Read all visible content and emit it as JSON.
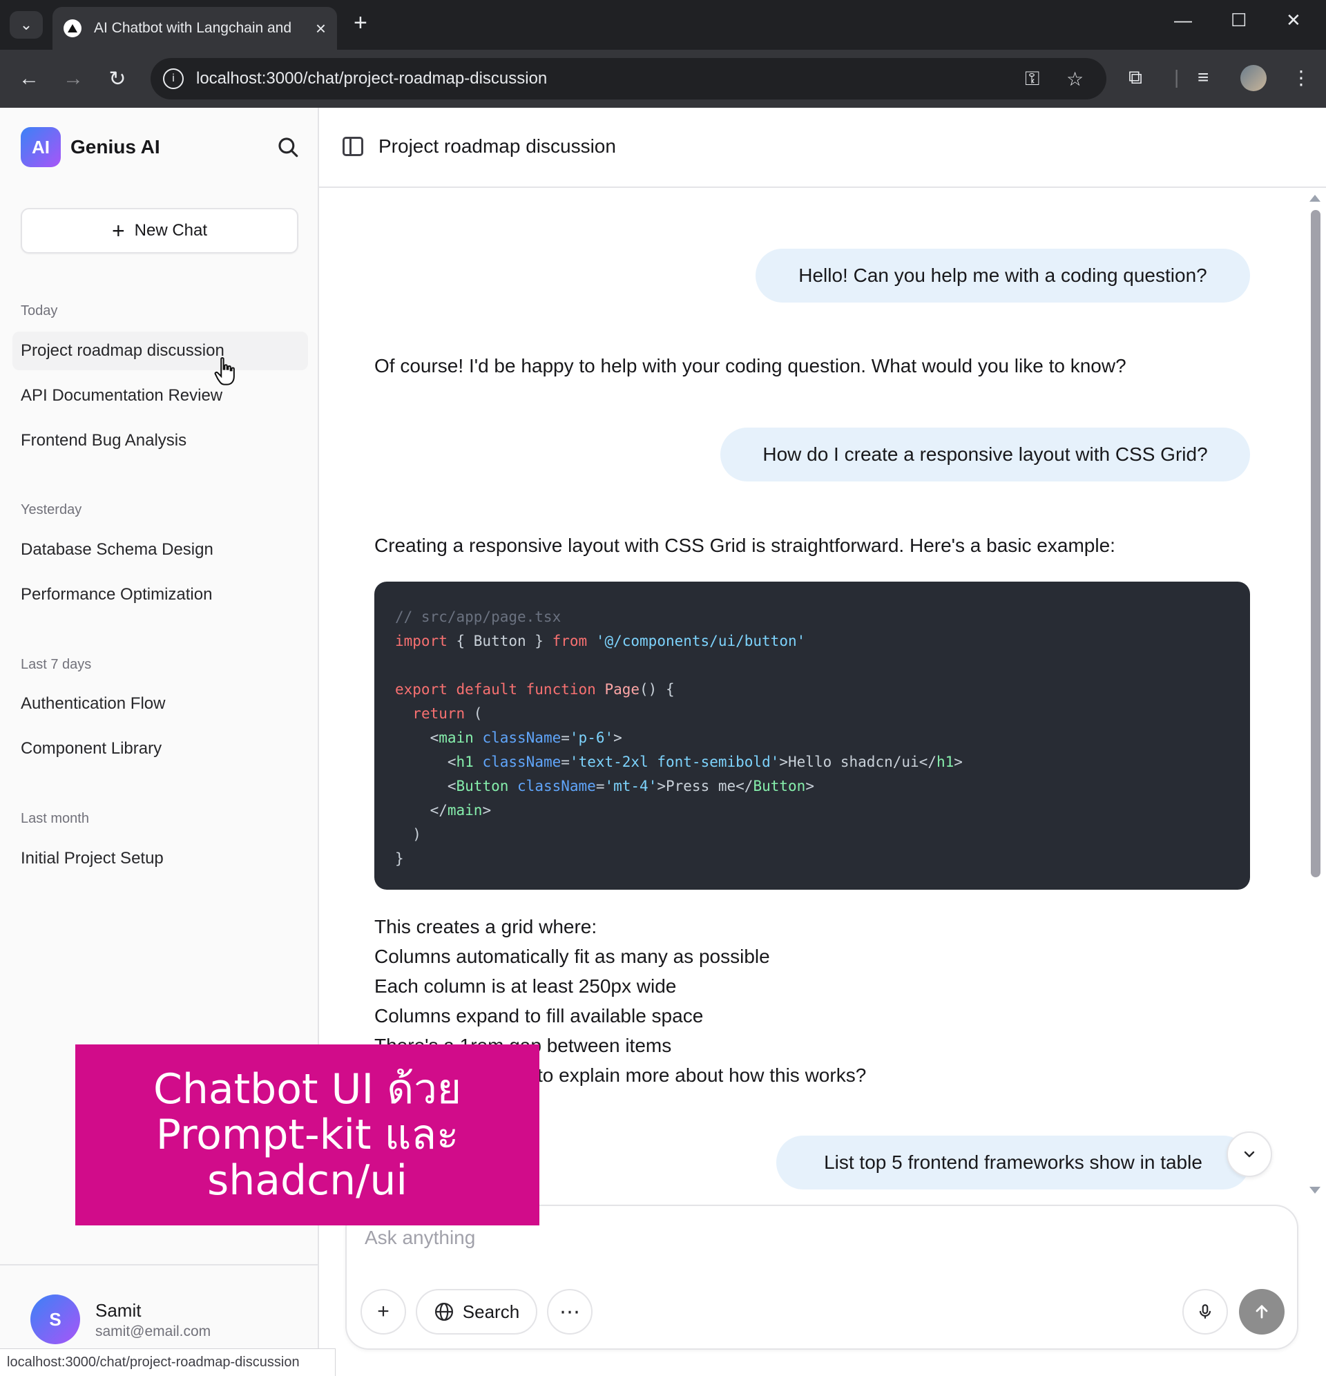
{
  "browser": {
    "tab_title": "AI Chatbot with Langchain and",
    "url": "localhost:3000/chat/project-roadmap-discussion",
    "status_url": "localhost:3000/chat/project-roadmap-discussion"
  },
  "sidebar": {
    "brand_logo": "AI",
    "brand_name": "Genius AI",
    "new_chat_label": "New Chat",
    "groups": [
      {
        "label": "Today",
        "items": [
          "Project roadmap discussion",
          "API Documentation Review",
          "Frontend Bug Analysis"
        ]
      },
      {
        "label": "Yesterday",
        "items": [
          "Database Schema Design",
          "Performance Optimization"
        ]
      },
      {
        "label": "Last 7 days",
        "items": [
          "Authentication Flow",
          "Component Library"
        ]
      },
      {
        "label": "Last month",
        "items": [
          "Initial Project Setup"
        ]
      }
    ],
    "user": {
      "initial": "S",
      "name": "Samit",
      "email": "samit@email.com"
    }
  },
  "main": {
    "title": "Project roadmap discussion",
    "messages": {
      "m1": "Hello! Can you help me with a coding question?",
      "m2": "Of course! I'd be happy to help with your coding question. What would you like to know?",
      "m3": "How do I create a responsive layout with CSS Grid?",
      "m4": "Creating a responsive layout with CSS Grid is straightforward. Here's a basic example:",
      "m4_lines": [
        "This creates a grid where:",
        "Columns automatically fit as many as possible",
        "Each column is at least 250px wide",
        "Columns expand to fill available space",
        "There's a 1rem gap between items",
        "Would you like me to explain more about how this works?"
      ],
      "m5": "List  top 5 frontend frameworks show in table"
    },
    "code": {
      "comment": "// src/app/page.tsx",
      "import_kw": "import",
      "import_body": " { Button } ",
      "from_kw": "from",
      "import_path": "'@/components/ui/button'",
      "export_kw": "export default function",
      "fn_name": "Page",
      "fn_tail": "() {",
      "return_kw": "return",
      "return_tail": " (",
      "main_open_tag": "main",
      "attr_class": "className",
      "main_class": "'p-6'",
      "h1_tag": "h1",
      "h1_class": "'text-2xl font-semibold'",
      "h1_text": "Hello shadcn/ui",
      "button_tag": "Button",
      "button_class": "'mt-4'",
      "button_text": "Press me",
      "close_paren": ")",
      "close_brace": "}"
    }
  },
  "composer": {
    "placeholder": "Ask anything",
    "search_label": "Search"
  },
  "overlay": {
    "lines": [
      "Chatbot UI ด้วย",
      "Prompt-kit และ",
      "shadcn/ui"
    ]
  },
  "colors": {
    "accent_gradient_start": "#3b82f6",
    "accent_gradient_end": "#a855f7",
    "user_bubble": "#e6f1fb",
    "code_bg": "#282c34",
    "overlay_bg": "#d10c8a"
  }
}
